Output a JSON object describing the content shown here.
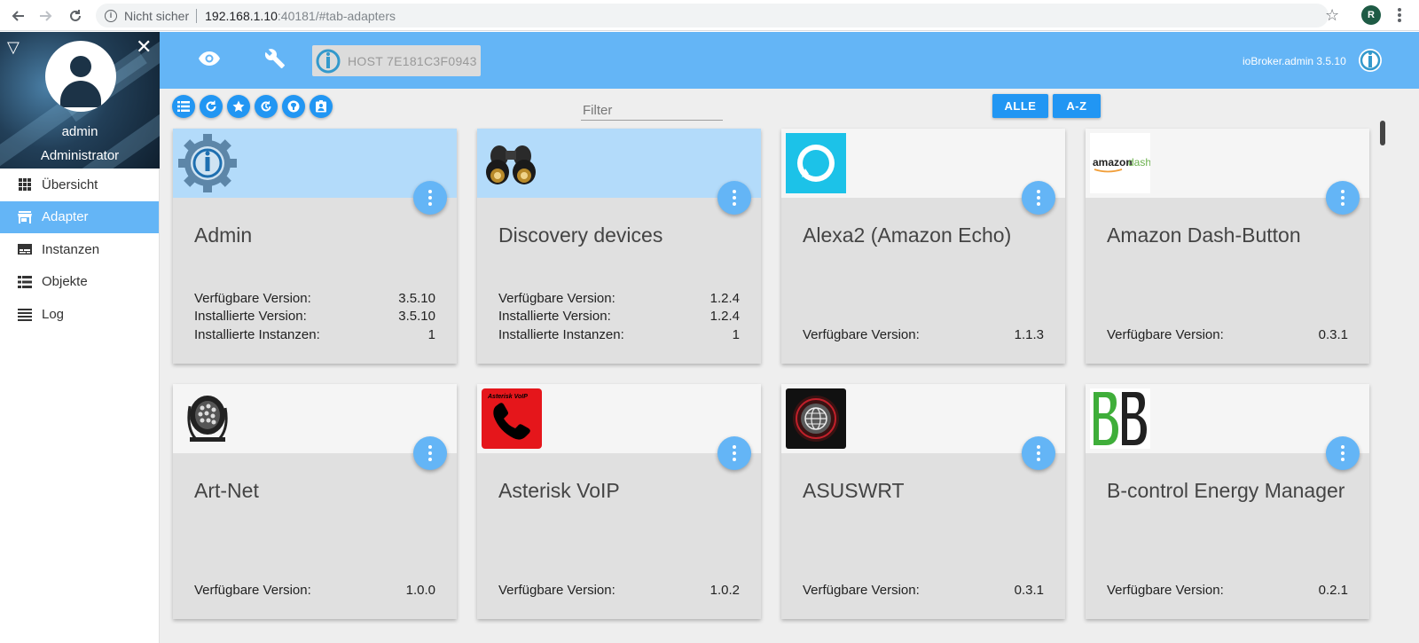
{
  "browser": {
    "not_secure": "Nicht sicher",
    "url_host": "192.168.1.10",
    "url_rest": ":40181/#tab-adapters",
    "profile_initial": "R"
  },
  "sidebar": {
    "user_name": "admin",
    "user_role": "Administrator",
    "items": [
      {
        "label": "Übersicht",
        "icon": "grid-icon"
      },
      {
        "label": "Adapter",
        "icon": "store-icon",
        "active": true
      },
      {
        "label": "Instanzen",
        "icon": "instances-icon"
      },
      {
        "label": "Objekte",
        "icon": "list-icon"
      },
      {
        "label": "Log",
        "icon": "log-icon"
      }
    ]
  },
  "header": {
    "host_label": "HOST 7E181C3F0943",
    "version": "ioBroker.admin 3.5.10"
  },
  "toolbar": {
    "filter_placeholder": "Filter",
    "all_label": "ALLE",
    "sort_label": "A-Z"
  },
  "colors": {
    "accent": "#64b5f6",
    "button": "#2196f3",
    "installed_header": "#b3dbfa"
  },
  "adapters": [
    {
      "title": "Admin",
      "icon": "admin-gear-icon",
      "installed": true,
      "rows": [
        {
          "label": "Verfügbare Version:",
          "value": "3.5.10"
        },
        {
          "label": "Installierte Version:",
          "value": "3.5.10"
        },
        {
          "label": "Installierte Instanzen:",
          "value": "1"
        }
      ]
    },
    {
      "title": "Discovery devices",
      "icon": "binoculars-icon",
      "installed": true,
      "rows": [
        {
          "label": "Verfügbare Version:",
          "value": "1.2.4"
        },
        {
          "label": "Installierte Version:",
          "value": "1.2.4"
        },
        {
          "label": "Installierte Instanzen:",
          "value": "1"
        }
      ]
    },
    {
      "title": "Alexa2 (Amazon Echo)",
      "icon": "alexa-icon",
      "installed": false,
      "rows": [
        {
          "label": "Verfügbare Version:",
          "value": "1.1.3"
        }
      ]
    },
    {
      "title": "Amazon Dash-Button",
      "icon": "amazon-dash-icon",
      "installed": false,
      "logo_text_a": "amazon",
      "logo_text_b": "dash",
      "rows": [
        {
          "label": "Verfügbare Version:",
          "value": "0.3.1"
        }
      ]
    },
    {
      "title": "Art-Net",
      "icon": "spotlight-icon",
      "installed": false,
      "rows": [
        {
          "label": "Verfügbare Version:",
          "value": "1.0.0"
        }
      ]
    },
    {
      "title": "Asterisk VoIP",
      "icon": "phone-icon",
      "installed": false,
      "logo_text": "Asterisk VoIP",
      "rows": [
        {
          "label": "Verfügbare Version:",
          "value": "1.0.2"
        }
      ]
    },
    {
      "title": "ASUSWRT",
      "icon": "globe-icon",
      "installed": false,
      "rows": [
        {
          "label": "Verfügbare Version:",
          "value": "0.3.1"
        }
      ]
    },
    {
      "title": "B-control Energy Manager",
      "icon": "bcontrol-icon",
      "installed": false,
      "rows": [
        {
          "label": "Verfügbare Version:",
          "value": "0.2.1"
        }
      ]
    }
  ]
}
